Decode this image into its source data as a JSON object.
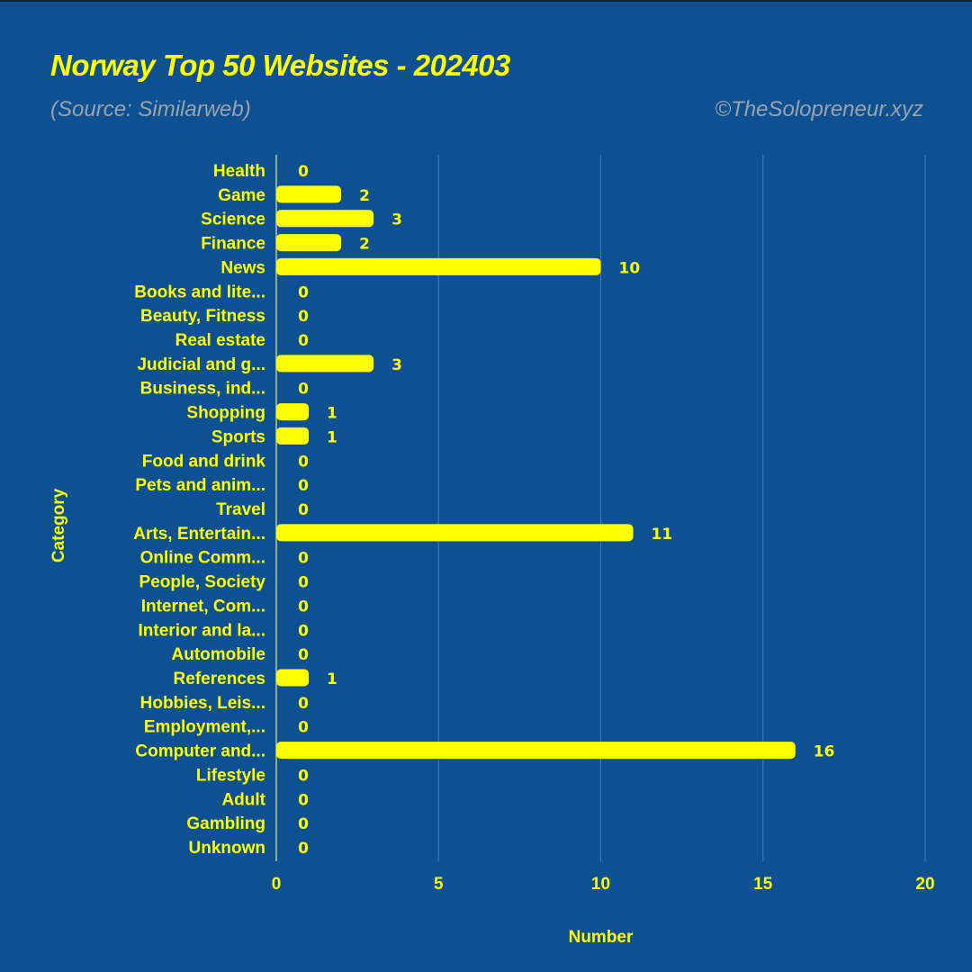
{
  "header": {
    "title": "Norway Top 50 Websites - 202403",
    "source": "(Source: Similarweb)",
    "credit": "©TheSolopreneur.xyz"
  },
  "colors": {
    "background": "#0e5193",
    "bar": "#ffff00",
    "text": "#ffff00",
    "subtitle": "#9aa3ad",
    "gridline": "#4f7fb3"
  },
  "chart_data": {
    "type": "bar",
    "orientation": "horizontal",
    "title": "Norway Top 50 Websites - 202403",
    "subtitle": "(Source: Similarweb)",
    "xlabel": "Number",
    "ylabel": "Category",
    "xlim": [
      0,
      20
    ],
    "xticks": [
      0,
      5,
      10,
      15,
      20
    ],
    "grid": true,
    "legend": "none",
    "categories": [
      "Health",
      "Game",
      "Science",
      "Finance",
      "News",
      "Books and lite...",
      "Beauty, Fitness",
      "Real estate",
      "Judicial and g...",
      "Business, ind...",
      "Shopping",
      "Sports",
      "Food and drink",
      "Pets and anim...",
      "Travel",
      "Arts, Entertain...",
      "Online Comm...",
      "People, Society",
      "Internet, Com...",
      "Interior and la...",
      "Automobile",
      "References",
      "Hobbies, Leis...",
      "Employment,...",
      "Computer and...",
      "Lifestyle",
      "Adult",
      "Gambling",
      "Unknown"
    ],
    "values": [
      0,
      2,
      3,
      2,
      10,
      0,
      0,
      0,
      3,
      0,
      1,
      1,
      0,
      0,
      0,
      11,
      0,
      0,
      0,
      0,
      0,
      1,
      0,
      0,
      16,
      0,
      0,
      0,
      0
    ]
  }
}
